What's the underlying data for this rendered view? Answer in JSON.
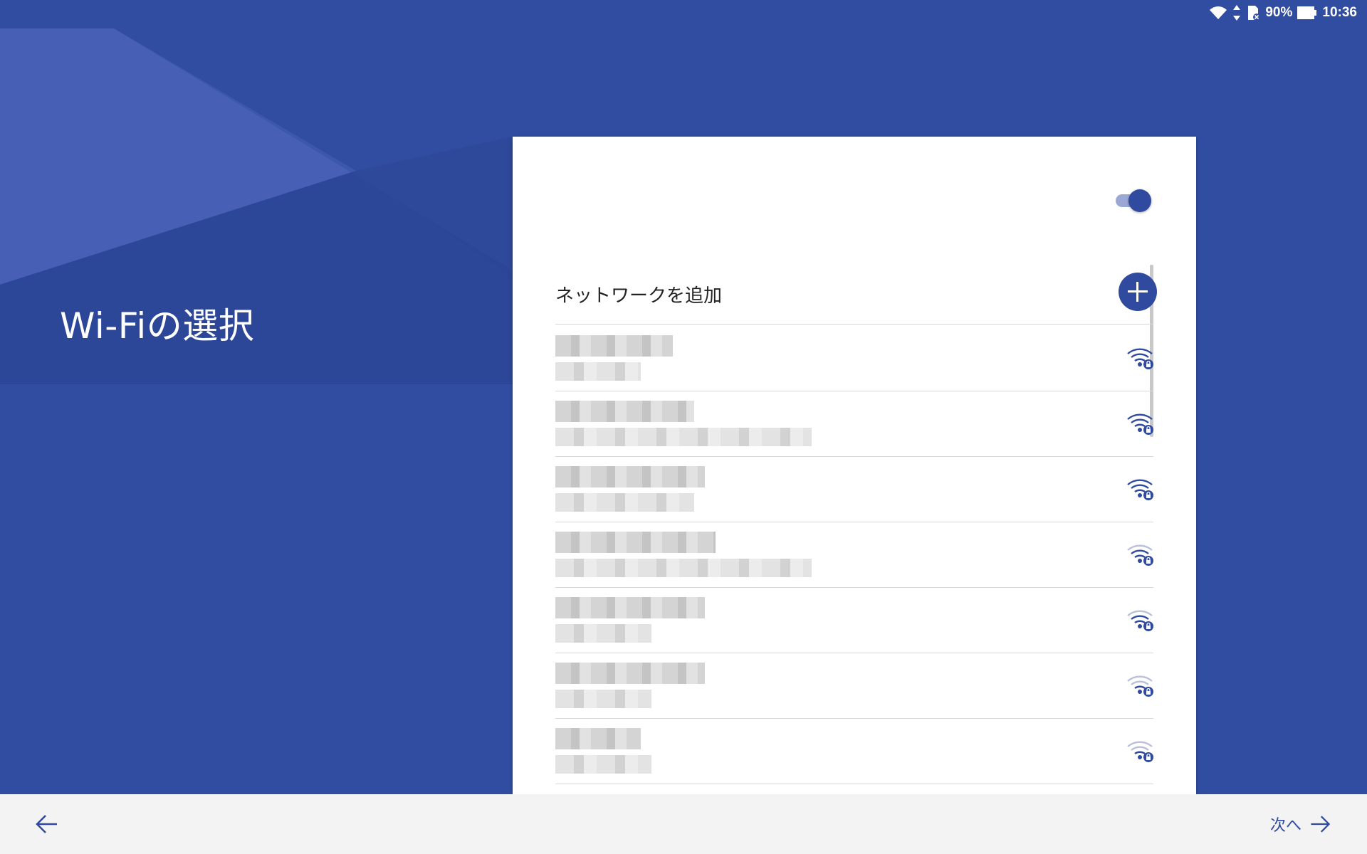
{
  "status_bar": {
    "battery_text": "90%",
    "time": "10:36",
    "icons": [
      "wifi-icon",
      "data-arrows-icon",
      "sd-card-icon",
      "battery-icon"
    ]
  },
  "page": {
    "title": "Wi-Fiの選択"
  },
  "card": {
    "wifi_toggle_on": true,
    "add_network_label": "ネットワークを追加",
    "networks": [
      {
        "ssid": "",
        "detail": "",
        "signal": "strong",
        "secured": true
      },
      {
        "ssid": "",
        "detail": "",
        "signal": "strong",
        "secured": true
      },
      {
        "ssid": "",
        "detail": "",
        "signal": "strong",
        "secured": true
      },
      {
        "ssid": "",
        "detail": "",
        "signal": "medium",
        "secured": true
      },
      {
        "ssid": "",
        "detail": "",
        "signal": "medium",
        "secured": true
      },
      {
        "ssid": "",
        "detail": "",
        "signal": "weak",
        "secured": true
      },
      {
        "ssid": "",
        "detail": "",
        "signal": "weak",
        "secured": true
      }
    ]
  },
  "navigation": {
    "next_label": "次へ"
  },
  "colors": {
    "accent": "#2f4a9f",
    "background": "#304da1",
    "bottom_bar": "#f3f3f3"
  }
}
